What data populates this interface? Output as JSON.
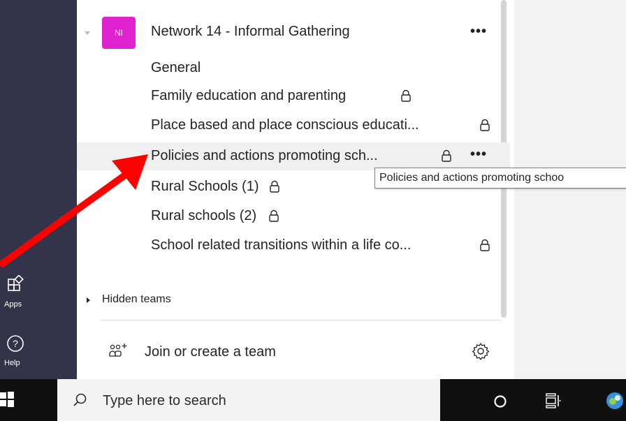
{
  "rail": {
    "apps_label": "Apps",
    "help_label": "Help"
  },
  "team": {
    "avatar_initials": "NI",
    "name": "Network 14 - Informal Gathering",
    "more_label": "•••"
  },
  "channels": [
    {
      "name": "General",
      "private": false
    },
    {
      "name": "Family education and parenting",
      "private": true
    },
    {
      "name": "Place based and place conscious educati...",
      "private": true
    },
    {
      "name": "Policies and actions promoting sch...",
      "private": true,
      "selected": true,
      "more_label": "•••"
    },
    {
      "name": "Rural Schools (1)",
      "private": true
    },
    {
      "name": "Rural schools (2)",
      "private": true
    },
    {
      "name": "School related transitions within a life co...",
      "private": true
    }
  ],
  "tooltip": {
    "text": "Policies and actions promoting schoo"
  },
  "hidden_teams": {
    "label": "Hidden teams"
  },
  "join": {
    "label": "Join or create a team"
  },
  "taskbar": {
    "search_placeholder": "Type here to search"
  },
  "colors": {
    "rail": "#33344a",
    "avatar": "#e021cf",
    "arrow": "#ff0000",
    "taskbar": "#101010"
  }
}
